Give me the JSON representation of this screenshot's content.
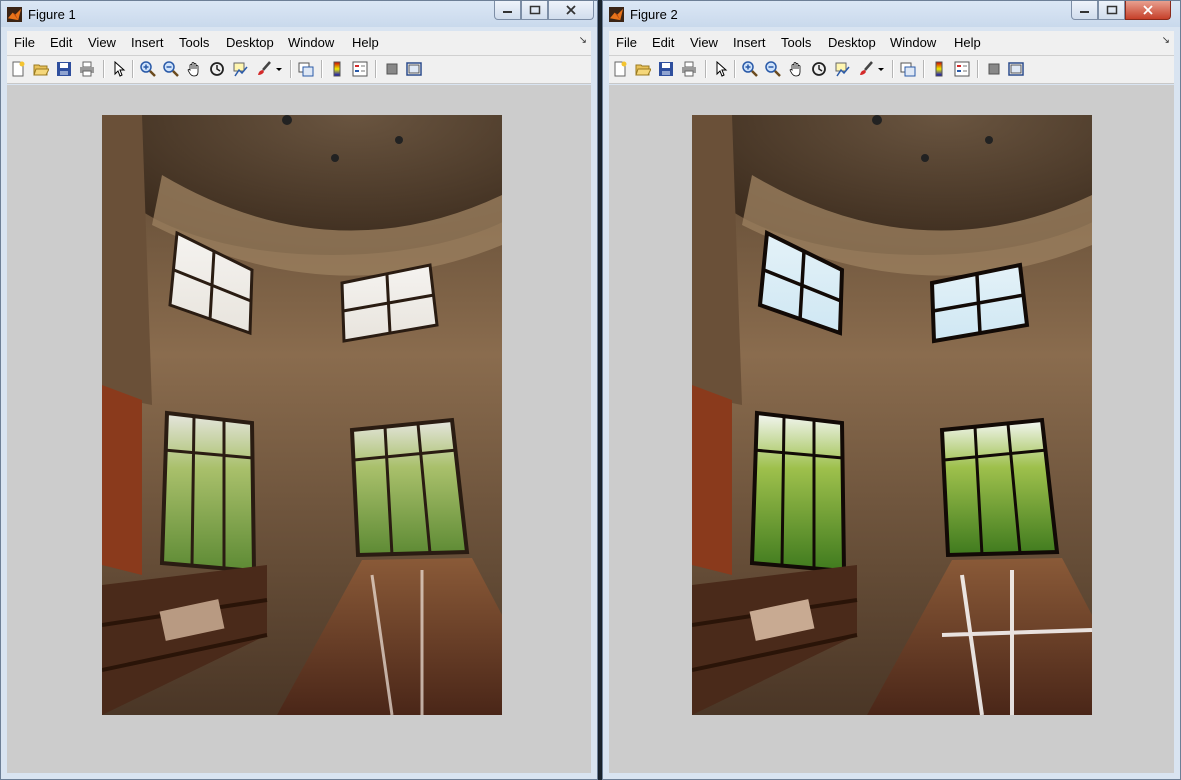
{
  "windows": [
    {
      "title": "Figure 1"
    },
    {
      "title": "Figure 2"
    }
  ],
  "menu": [
    "File",
    "Edit",
    "View",
    "Insert",
    "Tools",
    "Desktop",
    "Window",
    "Help"
  ],
  "menu_overflow_glyph": "↘",
  "toolbar_icons": [
    "new-figure-icon",
    "open-file-icon",
    "save-icon",
    "print-icon",
    "select-arrow-icon",
    "zoom-in-icon",
    "zoom-out-icon",
    "pan-hand-icon",
    "rotate-3d-icon",
    "data-cursor-icon",
    "brush-icon",
    "brush-dropdown-icon",
    "link-plot-icon",
    "colorbar-icon",
    "legend-icon",
    "hide-plot-tools-icon",
    "show-plot-tools-icon"
  ],
  "colors": {
    "canvas_bg": "#cccccc",
    "title_bg": "#d9e4f1",
    "close_hover": "#c6402a"
  }
}
